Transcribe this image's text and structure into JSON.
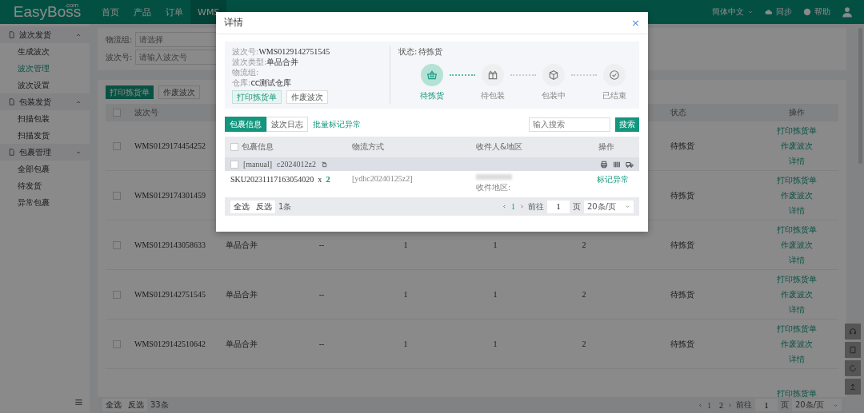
{
  "logo": {
    "name": "EasyBoss",
    "suffix": ".com"
  },
  "nav": [
    {
      "label": "首页",
      "selected": false
    },
    {
      "label": "产品",
      "selected": false
    },
    {
      "label": "订单",
      "selected": false
    },
    {
      "label": "WMS",
      "selected": true
    }
  ],
  "header_right": {
    "language": "簡体中文",
    "sync": "同步",
    "help": "帮助"
  },
  "sidebar": [
    {
      "label": "波次发货",
      "expanded": true,
      "children": [
        {
          "label": "生成波次",
          "selected": false
        },
        {
          "label": "波次管理",
          "selected": true
        },
        {
          "label": "波次设置",
          "selected": false
        }
      ]
    },
    {
      "label": "包装发货",
      "expanded": true,
      "children": [
        {
          "label": "扫描包装",
          "selected": false
        },
        {
          "label": "扫描发货",
          "selected": false
        }
      ]
    },
    {
      "label": "包裹管理",
      "expanded": true,
      "children": [
        {
          "label": "全部包裹",
          "selected": false
        },
        {
          "label": "待发货",
          "selected": false
        },
        {
          "label": "异常包裹",
          "selected": false
        }
      ]
    }
  ],
  "filters": [
    {
      "label": "物流组:",
      "placeholder": "请选择"
    },
    {
      "label": "波次号:",
      "placeholder": "请输入波次号"
    }
  ],
  "toolbar": [
    "打印拣货单",
    "作废波次"
  ],
  "table": {
    "all_checked": false,
    "columns": {
      "batch_no": "波次号",
      "status": "状态",
      "actions": "操作"
    },
    "rows": [
      {
        "checked": false,
        "batch_no": "WMS0129174454252",
        "status": "待拣货",
        "actions": [
          "打印拣货单",
          "作废波次",
          "详情"
        ]
      },
      {
        "checked": false,
        "batch_no": "WMS0129174301459",
        "status": "待拣货",
        "actions": [
          "打印拣货单",
          "作废波次",
          "详情"
        ]
      },
      {
        "checked": false,
        "batch_no": "WMS0129143058633",
        "type": "单品合并",
        "column_3": "--",
        "column_4": "1",
        "column_5": "1",
        "column_6": "2",
        "status": "待拣货",
        "actions": [
          "打印拣货单",
          "作废波次",
          "详情"
        ]
      },
      {
        "checked": false,
        "batch_no": "WMS0129142751545",
        "type": "单品合并",
        "column_3": "--",
        "column_4": "1",
        "column_5": "1",
        "column_6": "2",
        "status": "待拣货",
        "actions": [
          "打印拣货单",
          "作废波次",
          "详情"
        ]
      },
      {
        "checked": false,
        "batch_no": "WMS0129142510642",
        "type": "单品合并",
        "column_3": "--",
        "column_4": "1",
        "column_5": "1",
        "column_6": "2",
        "status": "待拣货",
        "actions": [
          "打印拣货单",
          "作废波次",
          "详情"
        ]
      },
      {
        "actions": [
          "打印拣货单"
        ]
      }
    ],
    "footer": {
      "select_all": "全选",
      "invert": "反选",
      "count": "33条",
      "pages": [
        {
          "label": "1",
          "selected": true
        },
        {
          "label": "2",
          "selected": false
        }
      ],
      "goto": "前往",
      "page_input": "1",
      "page_unit": "页",
      "page_size": "20条/页"
    }
  },
  "dialog": {
    "title": "详情",
    "close": "×",
    "info": [
      {
        "label": "波次号:",
        "value": "WMS0129142751545"
      },
      {
        "label": "波次类型:",
        "value": "单品合并"
      },
      {
        "label": "物流组:"
      },
      {
        "label": "仓库:",
        "value": "cc测试仓库"
      }
    ],
    "info_buttons": [
      "打印拣货单",
      "作废波次"
    ],
    "status_label": "状态:",
    "status_value": "待拣货",
    "steps": [
      {
        "label": "待拣货",
        "kind": "basket",
        "selected": true
      },
      {
        "label": "待包装",
        "kind": "unpack",
        "selected": false
      },
      {
        "label": "包装中",
        "kind": "pack",
        "selected": false
      },
      {
        "label": "已结束",
        "kind": "done",
        "selected": false
      }
    ],
    "tabs": [
      {
        "label": "包裹信息",
        "selected": true
      },
      {
        "label": "波次日志",
        "selected": false
      }
    ],
    "batch_link": "批量标记异常",
    "search_placeholder": "输入搜索",
    "search_button": "搜索",
    "all_checked": false,
    "columns": [
      "包裹信息",
      "物流方式",
      "收件人&地区",
      "操作"
    ],
    "package": {
      "checked": false,
      "source": "[manual]",
      "code": "c2024012z2",
      "sku": "SKU20231117163054020",
      "times": "x",
      "qty": "2",
      "logistics": "[ydhc20240125z2]",
      "region_label": "收件地区:",
      "action": "标记异常"
    },
    "footer": {
      "select_all": "全选",
      "invert": "反选",
      "count": "1条",
      "page": "1",
      "goto": "前往",
      "page_input": "1",
      "page_unit": "页",
      "page_size": "20条/页"
    }
  }
}
